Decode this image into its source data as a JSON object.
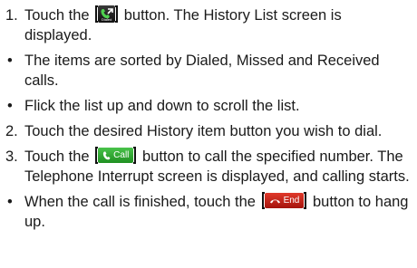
{
  "document": {
    "step1": {
      "num": "1.",
      "before": "Touch the",
      "after": "button. The History List screen is displayed.",
      "icon": "history-icon",
      "icon_caption": "Dialed"
    },
    "bullet1": "The items are sorted by Dialed, Missed and Received calls.",
    "bullet2": "Flick the list up and down to scroll the list.",
    "step2": {
      "num": "2.",
      "text": "Touch the desired History item button you wish to dial."
    },
    "step3": {
      "num": "3.",
      "before": "Touch the",
      "button_label": "Call",
      "after": "button to call the specified number. The Telephone Interrupt screen is displayed, and calling starts.",
      "icon": "phone-icon"
    },
    "bullet3": {
      "before": "When the call is finished, touch the",
      "button_label": "End",
      "after": "button to hang up.",
      "icon": "hang-up-icon"
    },
    "colors": {
      "call_green": "#2fa832",
      "end_red": "#c8231a"
    }
  }
}
